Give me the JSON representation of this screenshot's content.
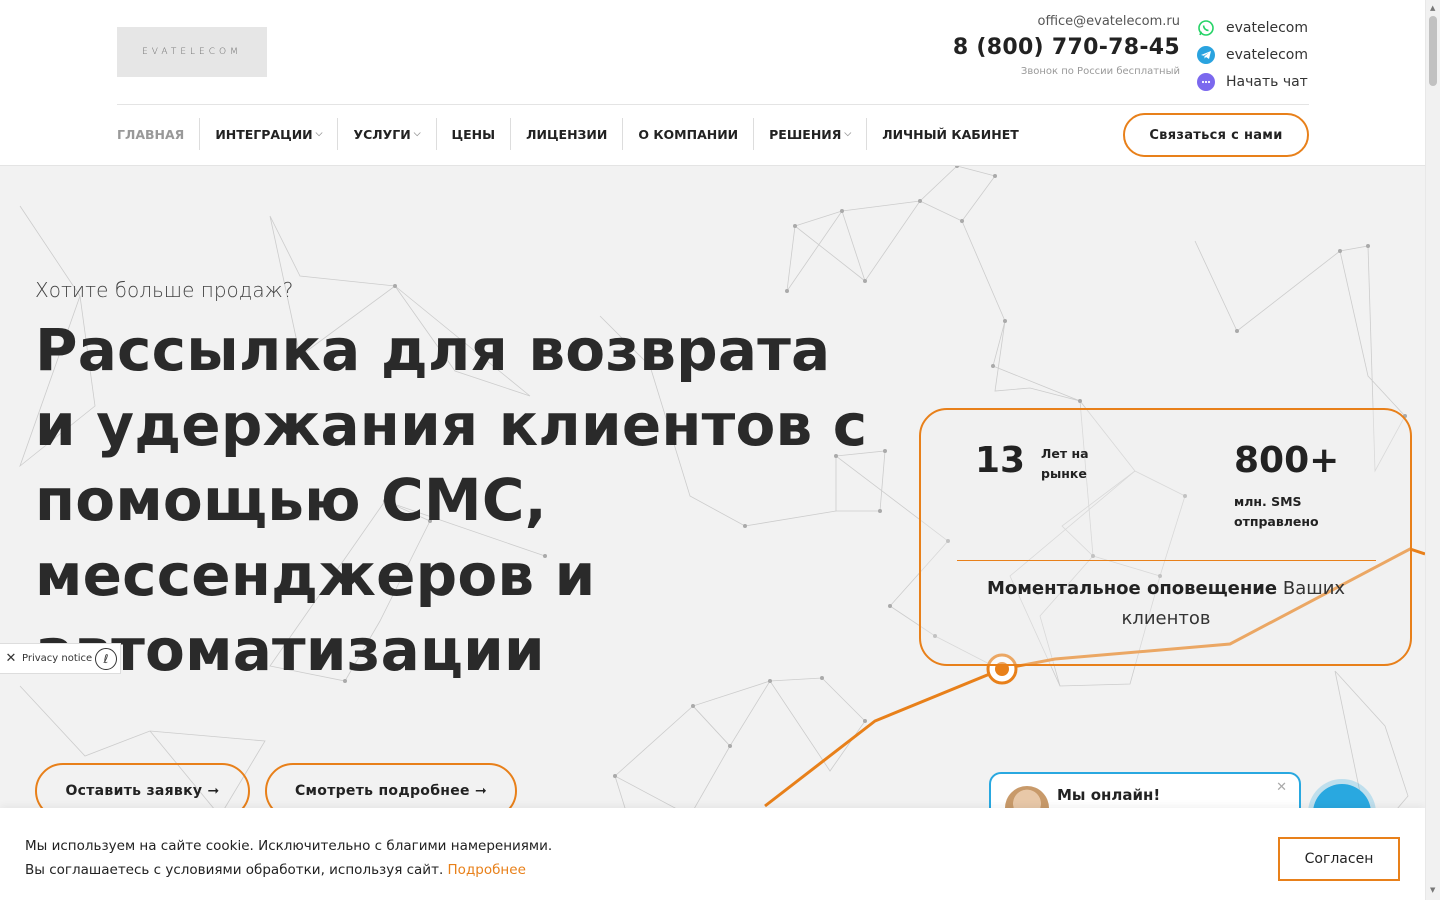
{
  "header": {
    "logo_text": "EVATELECOM",
    "email": "office@evatelecom.ru",
    "phone": "8 (800) 770-78-45",
    "phone_note": "Звонок по России бесплатный",
    "messengers": [
      {
        "icon": "whatsapp-icon",
        "label": "evatelecom",
        "color": "#25d366"
      },
      {
        "icon": "telegram-icon",
        "label": "evatelecom",
        "color": "#2aa3df"
      },
      {
        "icon": "chat-icon",
        "label": "Начать чат",
        "color": "#7b68ee"
      }
    ],
    "nav": [
      {
        "label": "ГЛАВНАЯ",
        "dropdown": false
      },
      {
        "label": "ИНТЕГРАЦИИ",
        "dropdown": true
      },
      {
        "label": "УСЛУГИ",
        "dropdown": true
      },
      {
        "label": "ЦЕНЫ",
        "dropdown": false
      },
      {
        "label": "ЛИЦЕНЗИИ",
        "dropdown": false
      },
      {
        "label": "О КОМПАНИИ",
        "dropdown": false
      },
      {
        "label": "РЕШЕНИЯ",
        "dropdown": true
      },
      {
        "label": "ЛИЧНЫЙ КАБИНЕТ",
        "dropdown": false
      }
    ],
    "contact_button": "Связаться с нами"
  },
  "hero": {
    "kicker": "Хотите больше продаж?",
    "title": "Рассылка для возврата и удержания клиентов с помощью СМС, мессенджеров и автоматизации",
    "button_primary": "Оставить заявку ➞",
    "button_secondary": "Смотреть подробнее ➞"
  },
  "stats": {
    "years_value": "13",
    "years_label_1": "Лет на",
    "years_label_2": "рынке",
    "sms_value": "800+",
    "sms_label_1": "млн. SMS",
    "sms_label_2": "отправлено",
    "bold_text": "Моментальное оповещение",
    "text": " Ваших клиентов"
  },
  "privacy": {
    "label": "Privacy notice"
  },
  "chat": {
    "title": "Мы онлайн!"
  },
  "cookie": {
    "line1": "Мы используем на сайте cookie. Исключительно с благими намерениями.",
    "line2": "Вы соглашаетесь с условиями обработки, используя сайт. ",
    "more": "Подробнее",
    "accept": "Согласен"
  },
  "colors": {
    "accent": "#e8801a",
    "chat_blue": "#29a8e0"
  }
}
